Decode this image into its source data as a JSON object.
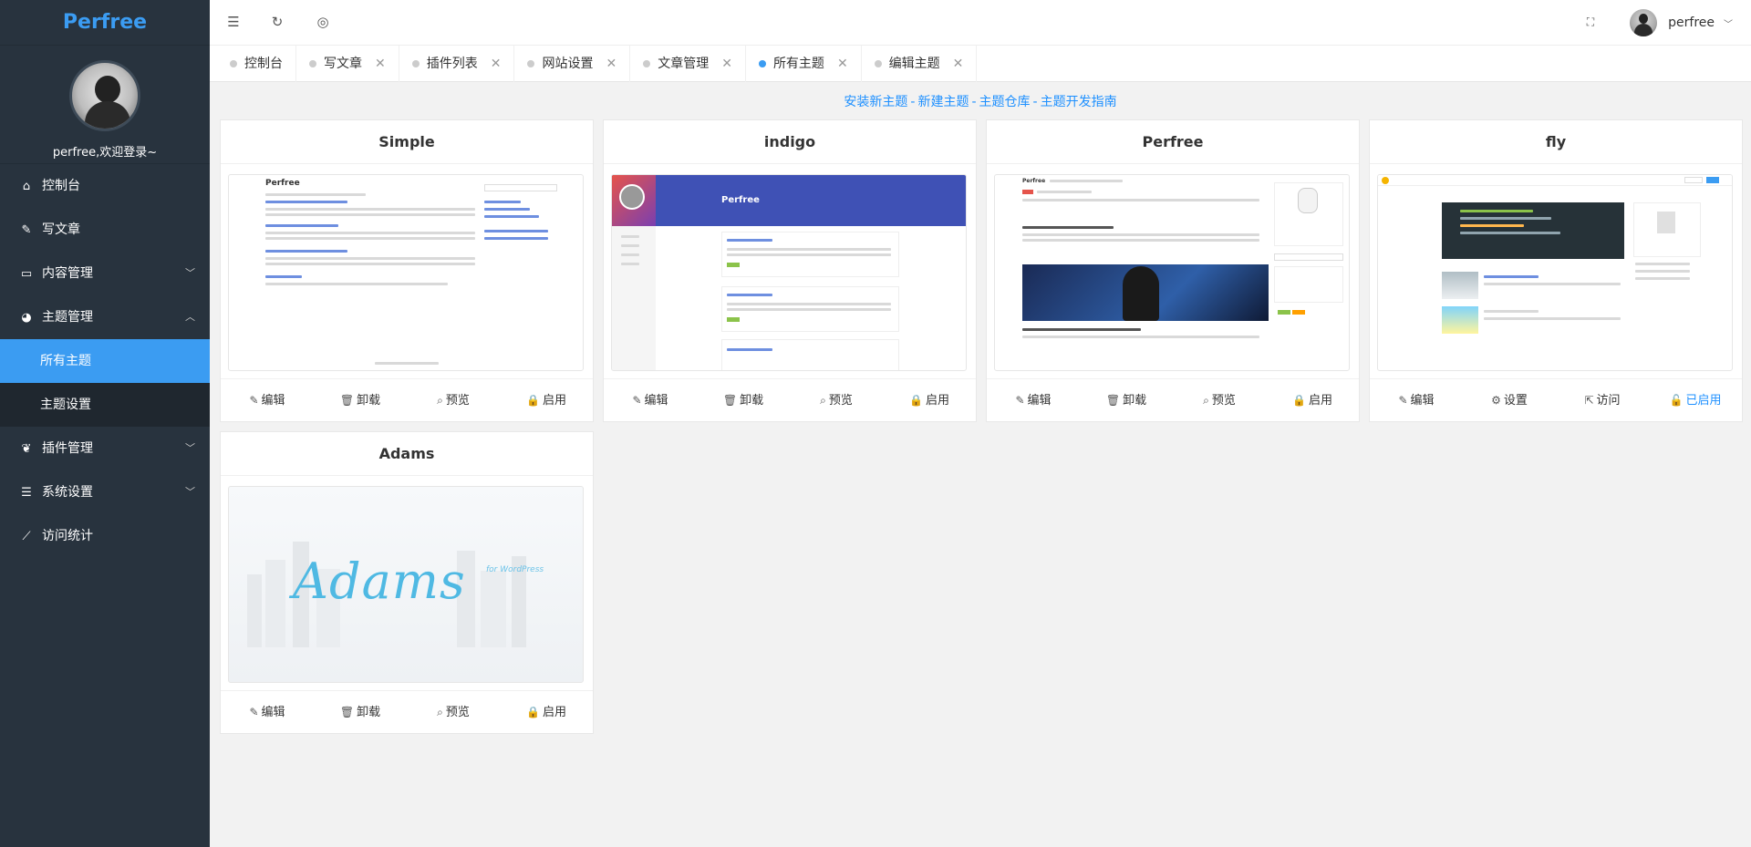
{
  "app": {
    "logo": "Perfree",
    "welcome": "perfree,欢迎登录~",
    "username": "perfree"
  },
  "sidebar": {
    "items": [
      {
        "label": "控制台",
        "icon": "home-icon"
      },
      {
        "label": "写文章",
        "icon": "edit-icon"
      },
      {
        "label": "内容管理",
        "icon": "inbox-icon"
      },
      {
        "label": "主题管理",
        "icon": "dashboard-icon"
      },
      {
        "label": "插件管理",
        "icon": "leaf-icon"
      },
      {
        "label": "系统设置",
        "icon": "sliders-icon"
      },
      {
        "label": "访问统计",
        "icon": "chart-icon"
      }
    ],
    "theme_sub": [
      {
        "label": "所有主题"
      },
      {
        "label": "主题设置"
      }
    ]
  },
  "header": {
    "icons": [
      "menu-toggle-icon",
      "refresh-icon",
      "globe-icon",
      "fullscreen-icon"
    ]
  },
  "tabs": [
    {
      "label": "控制台"
    },
    {
      "label": "写文章"
    },
    {
      "label": "插件列表"
    },
    {
      "label": "网站设置"
    },
    {
      "label": "文章管理"
    },
    {
      "label": "所有主题"
    },
    {
      "label": "编辑主题"
    }
  ],
  "links": {
    "install": "安装新主题",
    "create": "新建主题",
    "repo": "主题仓库",
    "guide": "主题开发指南",
    "sep": "-"
  },
  "themes": [
    {
      "name": "Simple",
      "actions": [
        "编辑",
        "卸载",
        "预览",
        "启用"
      ],
      "active": false
    },
    {
      "name": "indigo",
      "actions": [
        "编辑",
        "卸载",
        "预览",
        "启用"
      ],
      "active": false
    },
    {
      "name": "Perfree",
      "actions": [
        "编辑",
        "卸载",
        "预览",
        "启用"
      ],
      "active": false
    },
    {
      "name": "fly",
      "actions": [
        "编辑",
        "设置",
        "访问",
        "已启用"
      ],
      "active": true
    },
    {
      "name": "Adams",
      "actions": [
        "编辑",
        "卸载",
        "预览",
        "启用"
      ],
      "active": false
    }
  ],
  "previews": {
    "simple_title": "Perfree",
    "indigo_title": "Perfree",
    "perfree_title": "Perfree",
    "adams_logo": "Adams",
    "adams_sub": "for WordPress"
  },
  "colors": {
    "accent": "#3b9cf2",
    "sidebar": "#28333e",
    "link": "#1e90ff"
  }
}
